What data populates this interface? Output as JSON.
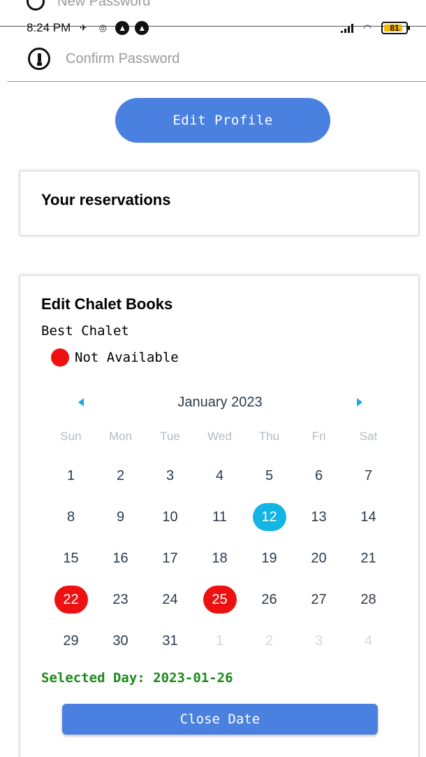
{
  "peek_field": {
    "placeholder": "New Password",
    "icon": "key-icon"
  },
  "status_bar": {
    "time": "8:24 PM",
    "battery": "81"
  },
  "confirm_password": {
    "placeholder": "Confirm Password",
    "icon": "key-icon"
  },
  "edit_profile": {
    "label": "Edit Profile"
  },
  "reservations": {
    "title": "Your reservations"
  },
  "booking": {
    "title": "Edit Chalet Books",
    "chalet_name": "Best Chalet",
    "legend_label": "Not Available",
    "legend_color": "#ee1111"
  },
  "calendar": {
    "month_label": "January 2023",
    "weekdays": [
      "Sun",
      "Mon",
      "Tue",
      "Wed",
      "Thu",
      "Fri",
      "Sat"
    ],
    "weeks": [
      [
        {
          "d": "1"
        },
        {
          "d": "2"
        },
        {
          "d": "3"
        },
        {
          "d": "4"
        },
        {
          "d": "5"
        },
        {
          "d": "6"
        },
        {
          "d": "7"
        }
      ],
      [
        {
          "d": "8"
        },
        {
          "d": "9"
        },
        {
          "d": "10"
        },
        {
          "d": "11"
        },
        {
          "d": "12",
          "state": "today"
        },
        {
          "d": "13"
        },
        {
          "d": "14"
        }
      ],
      [
        {
          "d": "15"
        },
        {
          "d": "16"
        },
        {
          "d": "17"
        },
        {
          "d": "18"
        },
        {
          "d": "19"
        },
        {
          "d": "20"
        },
        {
          "d": "21"
        }
      ],
      [
        {
          "d": "22",
          "state": "unavail"
        },
        {
          "d": "23"
        },
        {
          "d": "24"
        },
        {
          "d": "25",
          "state": "unavail"
        },
        {
          "d": "26"
        },
        {
          "d": "27"
        },
        {
          "d": "28"
        }
      ],
      [
        {
          "d": "29"
        },
        {
          "d": "30"
        },
        {
          "d": "31"
        },
        {
          "d": "1",
          "state": "muted"
        },
        {
          "d": "2",
          "state": "muted"
        },
        {
          "d": "3",
          "state": "muted"
        },
        {
          "d": "4",
          "state": "muted"
        }
      ]
    ],
    "today_color": "#14b4e4",
    "unavailable_color": "#ee1111"
  },
  "selected_day": "Selected Day: 2023-01-26",
  "close_date": {
    "label": "Close Date"
  },
  "colors": {
    "accent": "#4a80e0",
    "selected_text": "#1a8a1a"
  }
}
